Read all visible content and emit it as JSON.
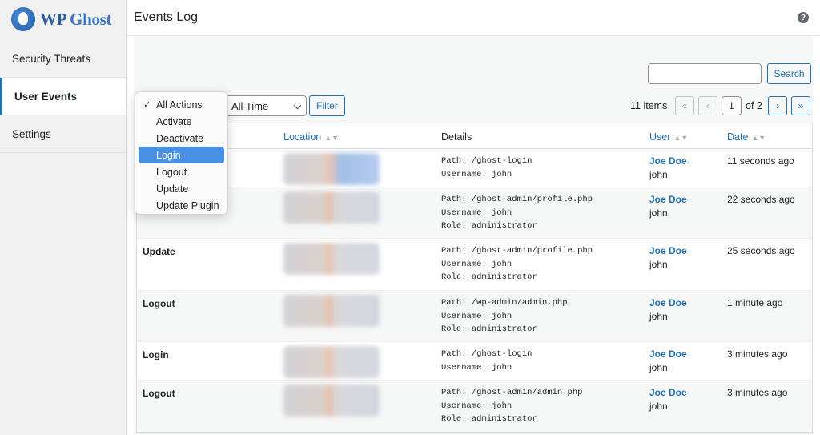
{
  "app": {
    "logo_wp": "WP",
    "logo_ghost": "Ghost",
    "page_title": "Events Log",
    "help_symbol": "?"
  },
  "sidebar": {
    "items": [
      {
        "label": "Security Threats",
        "active": false
      },
      {
        "label": "User Events",
        "active": true
      },
      {
        "label": "Settings",
        "active": false
      }
    ]
  },
  "toolbar": {
    "search_value": "",
    "search_label": "Search",
    "time_filter_value": "All Time",
    "filter_label": "Filter",
    "items_count": "11 items",
    "pagination": {
      "first": "«",
      "prev": "‹",
      "current_page": "1",
      "of_label": "of 2",
      "next": "›",
      "last": "»"
    }
  },
  "action_dropdown": {
    "options": [
      "All Actions",
      "Activate",
      "Deactivate",
      "Login",
      "Logout",
      "Update",
      "Update Plugin"
    ],
    "checked": "All Actions",
    "highlighted": "Login",
    "check_mark": "✓"
  },
  "table": {
    "headers": {
      "location": "Location",
      "details": "Details",
      "user": "User",
      "date": "Date",
      "sort_symbol": "▲▼"
    },
    "rows": [
      {
        "action": "",
        "details": [
          "Path: /ghost-login",
          "Username: john"
        ],
        "user_name": "Joe Doe",
        "user_login": "john",
        "date": "11 seconds ago"
      },
      {
        "action": "",
        "details": [
          "Path: /ghost-admin/profile.php",
          "Username: john",
          "Role: administrator"
        ],
        "user_name": "Joe Doe",
        "user_login": "john",
        "date": "22 seconds ago"
      },
      {
        "action": "Update",
        "details": [
          "Path: /ghost-admin/profile.php",
          "Username: john",
          "Role: administrator"
        ],
        "user_name": "Joe Doe",
        "user_login": "john",
        "date": "25 seconds ago"
      },
      {
        "action": "Logout",
        "details": [
          "Path: /wp-admin/admin.php",
          "Username: john",
          "Role: administrator"
        ],
        "user_name": "Joe Doe",
        "user_login": "john",
        "date": "1 minute ago"
      },
      {
        "action": "Login",
        "details": [
          "Path: /ghost-login",
          "Username: john"
        ],
        "user_name": "Joe Doe",
        "user_login": "john",
        "date": "3 minutes ago"
      },
      {
        "action": "Logout",
        "details": [
          "Path: /ghost-admin/admin.php",
          "Username: john",
          "Role: administrator"
        ],
        "user_name": "Joe Doe",
        "user_login": "john",
        "date": "3 minutes ago"
      }
    ]
  },
  "colors": {
    "accent": "#2271b1",
    "dropdown_highlight": "#4a90e2"
  }
}
